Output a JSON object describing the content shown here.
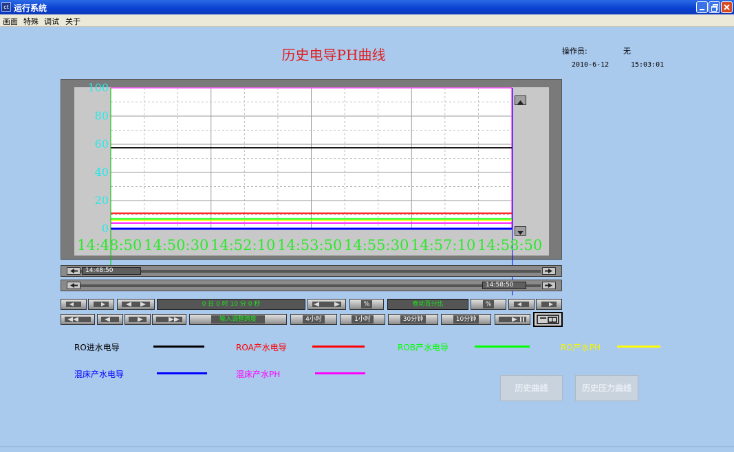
{
  "window": {
    "title": "运行系统",
    "icon_text": "ct"
  },
  "menu": {
    "items": [
      "画面",
      "特殊",
      "调试",
      "关于"
    ]
  },
  "header": {
    "title": "历史电导PH曲线",
    "operator_label": "操作员:",
    "operator_value": "无",
    "date": "2010-6-12",
    "time": "15:03:01"
  },
  "chart_data": {
    "type": "line",
    "ylim": [
      0,
      100
    ],
    "yticks": [
      "100",
      "80",
      "60",
      "40",
      "20",
      "0"
    ],
    "xticks": [
      "14:48:50",
      "14:50:30",
      "14:52:10",
      "14:53:50",
      "14:55:30",
      "14:57:10",
      "14:58:50"
    ],
    "series": [
      {
        "name": "RO进水电导",
        "color": "#000000",
        "values": [
          57.5,
          57.5,
          57.5,
          57.5,
          57.5,
          57.5,
          57.5
        ]
      },
      {
        "name": "ROA产水电导",
        "color": "#ff0000",
        "values": [
          11,
          11,
          11,
          11,
          11,
          11,
          11
        ]
      },
      {
        "name": "ROB产水电导",
        "color": "#00ff00",
        "values": [
          7,
          7,
          7,
          7,
          7,
          7,
          7
        ]
      },
      {
        "name": "RO产水PH",
        "color": "#ffff00",
        "values": [
          6,
          6,
          6,
          6,
          6,
          6,
          6
        ]
      },
      {
        "name": "混床产水电导",
        "color": "#0000ff",
        "values": [
          0,
          0,
          0,
          0,
          0,
          0,
          0
        ]
      },
      {
        "name": "混床产水PH",
        "color": "#ff00ff",
        "values": [
          4,
          4,
          4,
          4,
          4,
          4,
          4
        ]
      }
    ]
  },
  "scrollbars": {
    "start_label": "14:48:50",
    "end_label": "14:58:50"
  },
  "controls": {
    "time_span": "0 日 0 时 10 分 0 秒",
    "scroll_percent_label": "卷动百分比",
    "percent_sign": "%",
    "input_span_label": "输入调整跨度",
    "btn_4h": "4小时",
    "btn_1h": "1小时",
    "btn_30m": "30分钟",
    "btn_10m": "10分钟"
  },
  "buttons": {
    "history_curve": "历史曲线",
    "history_pressure_curve": "历史压力曲线"
  },
  "colors": {
    "background": "#a9c9ed",
    "title_red": "#e02020",
    "axis_cyan": "#28e8e8",
    "axis_green": "#2ce82c"
  }
}
